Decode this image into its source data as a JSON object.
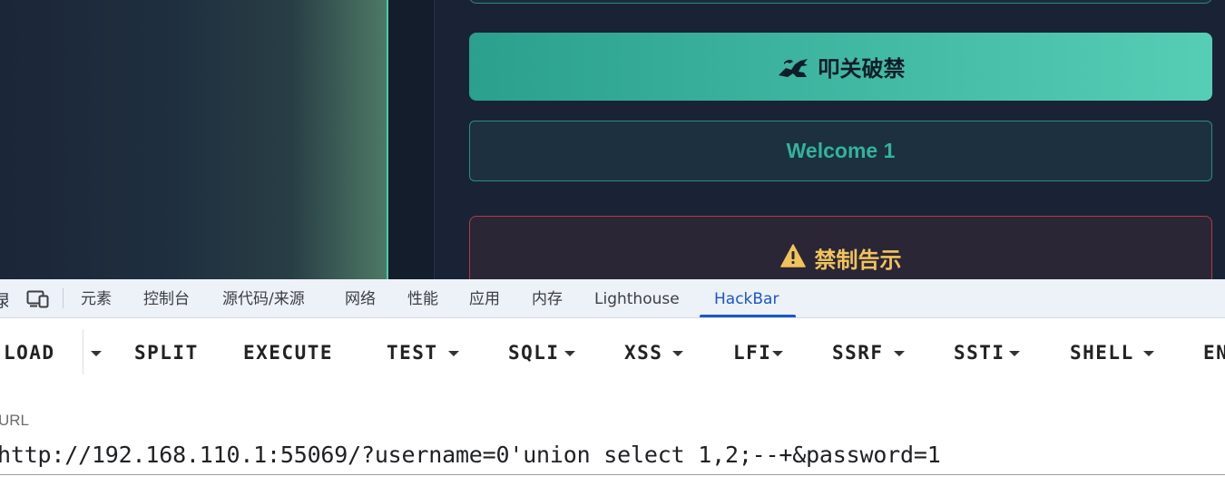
{
  "page": {
    "submit_button": {
      "label": "叩关破禁",
      "icon": "dragon-icon"
    },
    "welcome_message": "Welcome 1",
    "warning": {
      "icon": "warning-triangle-icon",
      "title": "禁制告示"
    },
    "colors": {
      "background": "#192336",
      "accent": "#2aa08d",
      "welcome_text": "#33b39a",
      "warning_text": "#f0c35c",
      "warning_border": "#b13c45"
    }
  },
  "devtools": {
    "partial_tab": "录",
    "tabs": [
      {
        "label": "元素"
      },
      {
        "label": "控制台"
      },
      {
        "label": "源代码/来源"
      },
      {
        "label": "网络"
      },
      {
        "label": "性能"
      },
      {
        "label": "应用"
      },
      {
        "label": "内存"
      },
      {
        "label": "Lighthouse"
      },
      {
        "label": "HackBar",
        "active": true
      }
    ],
    "active_color": "#1a57c7"
  },
  "hackbar": {
    "buttons": {
      "load": "LOAD",
      "split": "SPLIT",
      "execute": "EXECUTE",
      "test": "TEST",
      "sqli": "SQLI",
      "xss": "XSS",
      "lfi": "LFI",
      "ssrf": "SSRF",
      "ssti": "SSTI",
      "shell": "SHELL",
      "encoding": "EN"
    },
    "url_label": "URL",
    "url_value": "http://192.168.110.1:55069/?username=0'union select 1,2;--+&password=1"
  }
}
